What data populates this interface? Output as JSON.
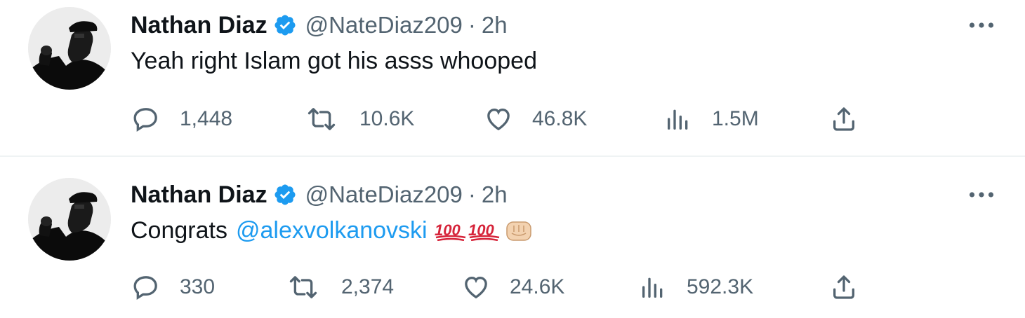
{
  "tweets": [
    {
      "name": "Nathan Diaz",
      "handle": "@NateDiaz209",
      "separator": "·",
      "time": "2h",
      "text": "Yeah right Islam got his asss whooped",
      "mention": "",
      "emojis": "",
      "replies": "1,448",
      "retweets": "10.6K",
      "likes": "46.8K",
      "views": "1.5M"
    },
    {
      "name": "Nathan Diaz",
      "handle": "@NateDiaz209",
      "separator": "·",
      "time": "2h",
      "text": "Congrats",
      "mention": "@alexvolkanovski",
      "emojis": [
        "hundred-points",
        "hundred-points",
        "oncoming-fist"
      ],
      "replies": "330",
      "retweets": "2,374",
      "likes": "24.6K",
      "views": "592.3K"
    }
  ],
  "colors": {
    "text_primary": "#0f1419",
    "text_secondary": "#536471",
    "link": "#1d9bf0",
    "verified": "#1d9bf0",
    "divider": "#eff3f4"
  },
  "icons": [
    "verified-badge-icon",
    "more-icon",
    "reply-icon",
    "retweet-icon",
    "like-icon",
    "views-icon",
    "share-icon",
    "hundred-points-emoji",
    "oncoming-fist-emoji"
  ]
}
